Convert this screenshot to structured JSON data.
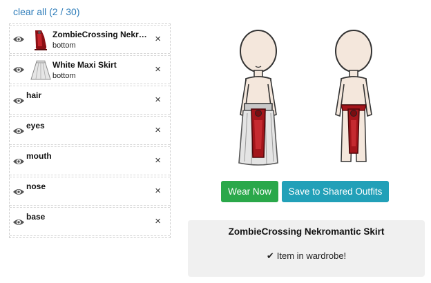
{
  "header": {
    "clear_all": "clear all (2 / 30)"
  },
  "slots": [
    {
      "title": "ZombieCrossing Nekro...",
      "subtitle": "bottom",
      "icon": "eye-icon",
      "thumb": "nekromantic-skirt-thumbnail"
    },
    {
      "title": "White Maxi Skirt",
      "subtitle": "bottom",
      "icon": "eye-icon",
      "thumb": "white-maxi-skirt-thumbnail"
    },
    {
      "title": "hair",
      "icon": "eye-icon"
    },
    {
      "title": "eyes",
      "icon": "eye-icon"
    },
    {
      "title": "mouth",
      "icon": "eye-icon"
    },
    {
      "title": "nose",
      "icon": "eye-icon"
    },
    {
      "title": "base",
      "icon": "eye-icon"
    }
  ],
  "close_glyph": "×",
  "actions": {
    "wear_now": "Wear Now",
    "save_shared": "Save to Shared Outfits"
  },
  "item_panel": {
    "name": "ZombieCrossing Nekromantic Skirt",
    "check_glyph": "✔",
    "status": "Item in wardrobe!"
  },
  "colors": {
    "link": "#2a7ab8",
    "wear_button": "#2aa84a",
    "save_button": "#22a0b8",
    "skirt_red": "#a3151b",
    "skin": "#f4e7dc"
  }
}
